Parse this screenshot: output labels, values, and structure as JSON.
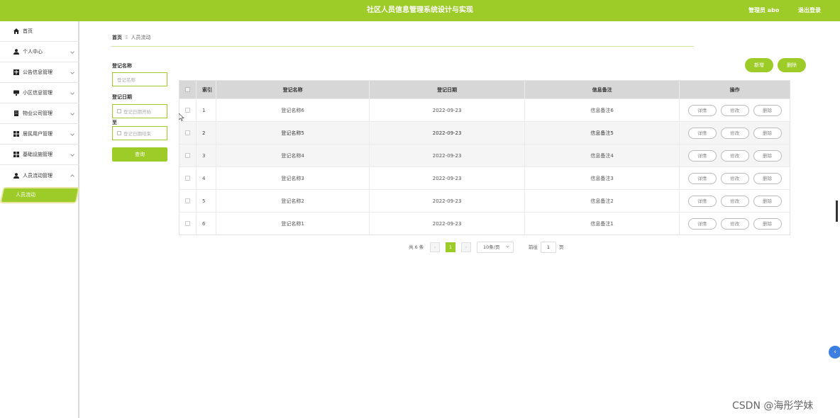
{
  "header": {
    "title": "社区人员信息管理系统设计与实现",
    "admin": "管理员 abo",
    "logout": "退出登录"
  },
  "sidebar": {
    "items": [
      {
        "label": "首页",
        "icon": "home-icon"
      },
      {
        "label": "个人中心",
        "icon": "user-icon"
      },
      {
        "label": "公告信息管理",
        "icon": "grid-icon"
      },
      {
        "label": "小区信息管理",
        "icon": "monitor-icon"
      },
      {
        "label": "物业公司管理",
        "icon": "building-icon"
      },
      {
        "label": "居民用户管理",
        "icon": "apps-icon"
      },
      {
        "label": "基础设施管理",
        "icon": "apps-icon"
      },
      {
        "label": "人员流动管理",
        "icon": "user-icon"
      }
    ],
    "active_sub": "人员流动"
  },
  "breadcrumb": {
    "home": "首页",
    "sep": "Ξ",
    "current": "人员流动"
  },
  "search": {
    "name_label": "登记名称",
    "name_placeholder": "登记名称",
    "date_label": "登记日期",
    "date_start_placeholder": "登记日期开始",
    "to_label": "至",
    "date_end_placeholder": "登记日期结束",
    "query_button": "查询"
  },
  "actions": {
    "add": "新增",
    "delete": "删除"
  },
  "table": {
    "headers": {
      "index": "索引",
      "name": "登记名称",
      "date": "登记日期",
      "note": "信息备注",
      "ops": "操作"
    },
    "rows": [
      {
        "index": "1",
        "name": "登记名称6",
        "date": "2022-09-23",
        "note": "信息备注6"
      },
      {
        "index": "2",
        "name": "登记名称5",
        "date": "2022-09-23",
        "note": "信息备注5"
      },
      {
        "index": "3",
        "name": "登记名称4",
        "date": "2022-09-23",
        "note": "信息备注4"
      },
      {
        "index": "4",
        "name": "登记名称3",
        "date": "2022-09-23",
        "note": "信息备注3"
      },
      {
        "index": "5",
        "name": "登记名称2",
        "date": "2022-09-23",
        "note": "信息备注2"
      },
      {
        "index": "6",
        "name": "登记名称1",
        "date": "2022-09-23",
        "note": "信息备注1"
      }
    ],
    "op_labels": {
      "detail": "详情",
      "edit": "修改",
      "delete": "删除"
    }
  },
  "pagination": {
    "total": "共 6 条",
    "prev": "‹",
    "page": "1",
    "next": "›",
    "page_size": "10条/页",
    "goto": "前往",
    "goto_value": "1",
    "unit": "页"
  },
  "watermark": "CSDN @海彤学妹",
  "float_button": "‹",
  "colors": {
    "accent": "#9dcb27",
    "header_bg": "#9dcb27",
    "table_header_bg": "#d7d7d7"
  }
}
